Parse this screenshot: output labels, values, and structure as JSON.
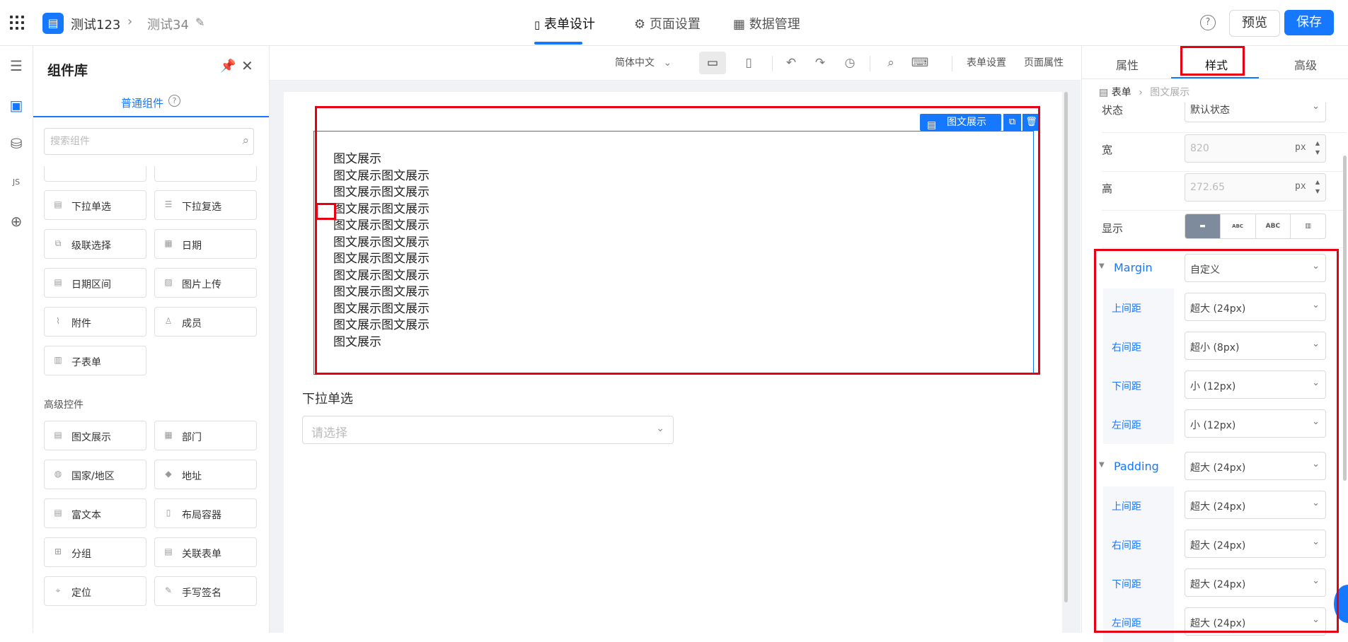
{
  "header": {
    "app_name": "测试123",
    "crumb_sep": "›",
    "page_name": "测试34",
    "app_logo": "▤",
    "tabs": [
      {
        "label": "表单设计",
        "icon": "📄"
      },
      {
        "label": "页面设置",
        "icon": "⚙"
      },
      {
        "label": "数据管理",
        "icon": "▦"
      }
    ],
    "help": "?",
    "preview_label": "预览",
    "save_label": "保存"
  },
  "component_panel": {
    "title": "组件库",
    "tab_label": "普通组件",
    "search_placeholder": "搜索组件",
    "basic_items": [
      {
        "label": "下拉单选"
      },
      {
        "label": "下拉复选"
      },
      {
        "label": "级联选择"
      },
      {
        "label": "日期"
      },
      {
        "label": "日期区间"
      },
      {
        "label": "图片上传"
      },
      {
        "label": "附件"
      },
      {
        "label": "成员"
      },
      {
        "label": "子表单"
      }
    ],
    "advanced_title": "高级控件",
    "advanced_items": [
      {
        "label": "图文展示"
      },
      {
        "label": "部门"
      },
      {
        "label": "国家/地区"
      },
      {
        "label": "地址"
      },
      {
        "label": "富文本"
      },
      {
        "label": "布局容器"
      },
      {
        "label": "分组"
      },
      {
        "label": "关联表单"
      },
      {
        "label": "定位"
      },
      {
        "label": "手写签名"
      }
    ]
  },
  "toolbar": {
    "language": "简体中文",
    "form_settings": "表单设置",
    "page_props": "页面属性"
  },
  "canvas": {
    "rich_component_tag": "图文展示",
    "rich_text_lines": [
      "图文展示",
      "图文展示图文展示",
      "图文展示图文展示",
      "图文展示图文展示",
      "图文展示图文展示",
      "图文展示图文展示",
      "图文展示图文展示",
      "图文展示图文展示",
      "图文展示图文展示",
      "图文展示图文展示",
      "图文展示图文展示",
      "图文展示"
    ],
    "select_label": "下拉单选",
    "select_placeholder": "请选择"
  },
  "properties": {
    "tabs": [
      "属性",
      "样式",
      "高级"
    ],
    "active_tab": "样式",
    "breadcrumb_root": "表单",
    "breadcrumb_current": "图文展示",
    "state_label": "状态",
    "state_value": "默认状态",
    "width_label": "宽",
    "width_value": "820",
    "height_label": "高",
    "height_value": "272.65",
    "unit": "px",
    "display_label": "显示",
    "display_options": [
      "",
      "ABC",
      "ABC",
      ""
    ],
    "margin": {
      "label": "Margin",
      "value": "自定义",
      "rows": [
        {
          "label": "上间距",
          "value": "超大 (24px)"
        },
        {
          "label": "右间距",
          "value": "超小 (8px)"
        },
        {
          "label": "下间距",
          "value": "小 (12px)"
        },
        {
          "label": "左间距",
          "value": "小 (12px)"
        }
      ]
    },
    "padding": {
      "label": "Padding",
      "value": "超大 (24px)",
      "rows": [
        {
          "label": "上间距",
          "value": "超大 (24px)"
        },
        {
          "label": "右间距",
          "value": "超大 (24px)"
        },
        {
          "label": "下间距",
          "value": "超大 (24px)"
        },
        {
          "label": "左间距",
          "value": "超大 (24px)"
        }
      ]
    }
  },
  "colors": {
    "accent": "#1677ff",
    "highlight": "#e60012"
  }
}
